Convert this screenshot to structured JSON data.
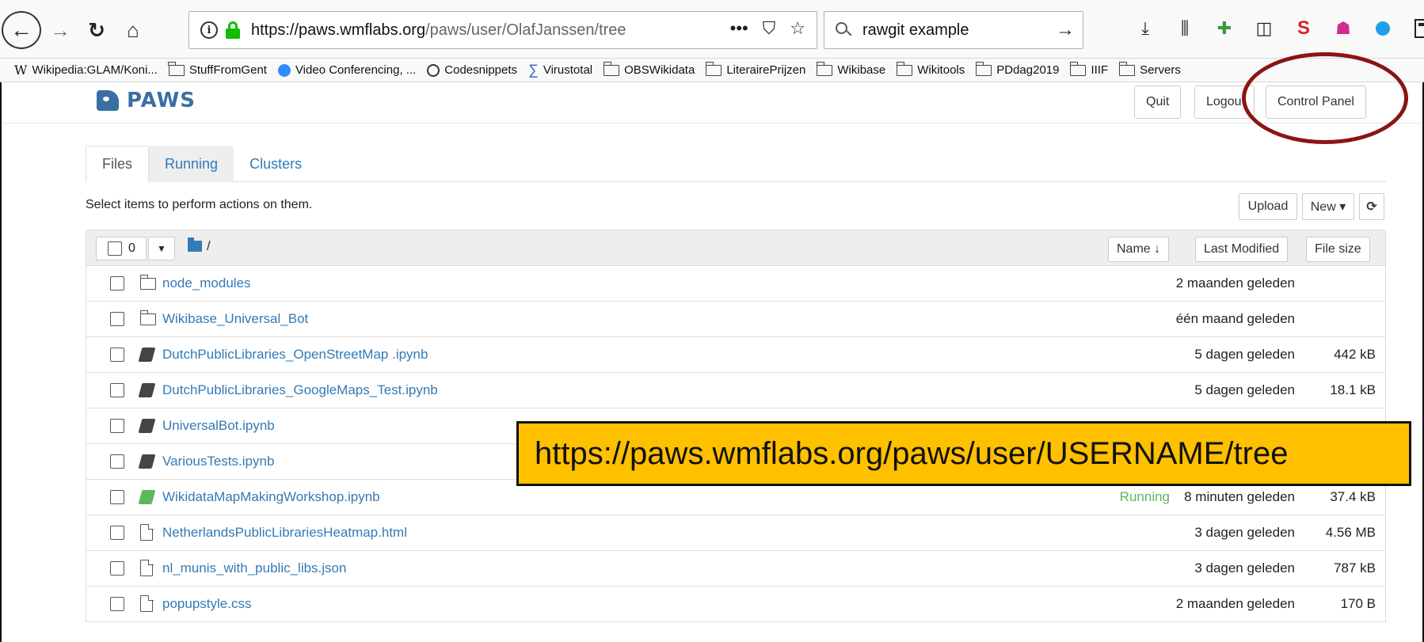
{
  "browser": {
    "url": {
      "domain": "https://paws.wmflabs.org",
      "path": "/paws/user/OlafJanssen/tree"
    },
    "search_text": "rawgit example",
    "url_actions": [
      "•••",
      "⛉",
      "☆"
    ],
    "bookmarks": [
      {
        "label": "Wikipedia:GLAM/Koni...",
        "icon": "wikipedia-icon"
      },
      {
        "label": "StuffFromGent",
        "icon": "folder-icon"
      },
      {
        "label": "Video Conferencing, ...",
        "icon": "zoom-icon"
      },
      {
        "label": "Codesnippets",
        "icon": "globe-icon"
      },
      {
        "label": "Virustotal",
        "icon": "sigma-icon"
      },
      {
        "label": "OBSWikidata",
        "icon": "folder-icon"
      },
      {
        "label": "LiterairePrijzen",
        "icon": "folder-icon"
      },
      {
        "label": "Wikibase",
        "icon": "folder-icon"
      },
      {
        "label": "Wikitools",
        "icon": "folder-icon"
      },
      {
        "label": "PDdag2019",
        "icon": "folder-icon"
      },
      {
        "label": "IIIF",
        "icon": "folder-icon"
      },
      {
        "label": "Servers",
        "icon": "folder-icon"
      }
    ]
  },
  "app": {
    "logo_text": "PAWS",
    "header_buttons": {
      "quit": "Quit",
      "logout": "Logou",
      "control_panel": "Control Panel"
    },
    "tabs": [
      "Files",
      "Running",
      "Clusters"
    ],
    "select_message": "Select items to perform actions on them.",
    "actions": {
      "upload": "Upload",
      "new": "New ▾",
      "refresh": "⟳"
    },
    "list_header": {
      "selected_count": "0",
      "crumb": "/",
      "sort_name": "Name ↓",
      "sort_modified": "Last Modified",
      "sort_size": "File size"
    },
    "files": [
      {
        "name": "node_modules",
        "type": "folder",
        "status": "",
        "modified": "2 maanden geleden",
        "size": ""
      },
      {
        "name": "Wikibase_Universal_Bot",
        "type": "folder",
        "status": "",
        "modified": "één maand geleden",
        "size": ""
      },
      {
        "name": " DutchPublicLibraries_OpenStreetMap .ipynb",
        "type": "notebook",
        "status": "",
        "modified": "5 dagen geleden",
        "size": "442 kB"
      },
      {
        "name": "DutchPublicLibraries_GoogleMaps_Test.ipynb",
        "type": "notebook",
        "status": "",
        "modified": "5 dagen geleden",
        "size": "18.1 kB"
      },
      {
        "name": "UniversalBot.ipynb",
        "type": "notebook",
        "status": "",
        "modified": "",
        "size": ""
      },
      {
        "name": "VariousTests.ipynb",
        "type": "notebook",
        "status": "",
        "modified": "",
        "size": ""
      },
      {
        "name": "WikidataMapMakingWorkshop.ipynb",
        "type": "notebook-running",
        "status": "Running",
        "modified": "8 minuten geleden",
        "size": "37.4 kB"
      },
      {
        "name": "NetherlandsPublicLibrariesHeatmap.html",
        "type": "file",
        "status": "",
        "modified": "3 dagen geleden",
        "size": "4.56 MB"
      },
      {
        "name": "nl_munis_with_public_libs.json",
        "type": "file",
        "status": "",
        "modified": "3 dagen geleden",
        "size": "787 kB"
      },
      {
        "name": "popupstyle.css",
        "type": "file",
        "status": "",
        "modified": "2 maanden geleden",
        "size": "170 B"
      }
    ]
  },
  "callout_text": "https://paws.wmflabs.org/paws/user/USERNAME/tree",
  "colors": {
    "link": "#337ab7",
    "running": "#5cb85c",
    "callout": "#ffc000",
    "highlight": "#8b1414"
  }
}
